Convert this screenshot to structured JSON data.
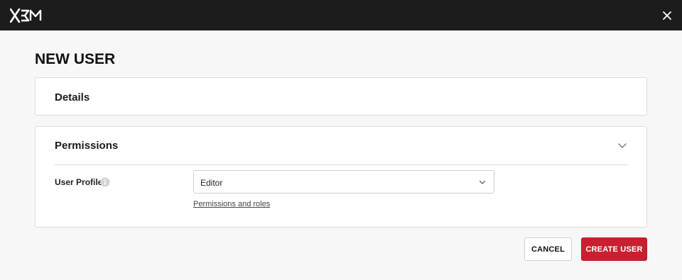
{
  "header": {
    "logo_text": "X3M",
    "logo_icon": "x3m-logo",
    "close_icon": "close-icon",
    "background": "#1c1c1c"
  },
  "page": {
    "title": "NEW USER"
  },
  "details_section": {
    "title": "Details"
  },
  "permissions_section": {
    "title": "Permissions",
    "expand_icon": "chevron-down-icon",
    "user_profile": {
      "label": "User Profile",
      "info_icon": "info-icon",
      "selected_value": "Editor",
      "select_icon": "chevron-down-icon"
    },
    "link_text": "Permissions and roles"
  },
  "footer": {
    "cancel_label": "CANCEL",
    "create_label": "CREATE USER",
    "accent_color": "#c8202f"
  }
}
